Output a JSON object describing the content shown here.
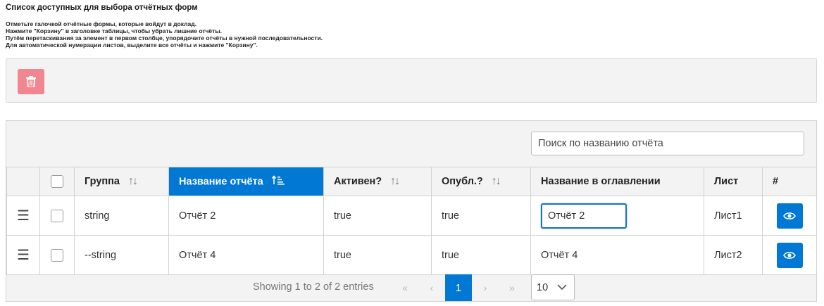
{
  "header": {
    "title": "Список доступных для выбора отчётных форм",
    "instructions": [
      "Отметьте галочкой отчётные формы, которые войдут в доклад.",
      "Нажмите \"Корзину\" в заголовке таблицы, чтобы убрать лишние отчёты.",
      "Путём перетаскивания за элемент в первом столбце, упорядочите отчёты в нужной последовательности.",
      "Для автоматической нумерации листов, выделите все отчёты и нажмите \"Корзину\"."
    ]
  },
  "toolbar": {
    "delete_icon": "trash-icon",
    "delete_color": "#f0868f"
  },
  "search": {
    "placeholder": "Поиск по названию отчёта",
    "value": ""
  },
  "table": {
    "columns": {
      "group": "Группа",
      "name": "Название отчёта",
      "active": "Активен?",
      "published": "Опубл.?",
      "toc_name": "Название в оглавлении",
      "sheet": "Лист",
      "actions": "#"
    },
    "sorted_column": "name",
    "sort_direction": "ascending",
    "rows": [
      {
        "group": "string",
        "name": "Отчёт 2",
        "active": "true",
        "published": "true",
        "toc_name": "Отчёт 2",
        "sheet": "Лист1",
        "editing": true
      },
      {
        "group": "--string",
        "name": "Отчёт 4",
        "active": "true",
        "published": "true",
        "toc_name": "Отчёт 4",
        "sheet": "Лист2",
        "editing": false
      }
    ]
  },
  "pagination": {
    "info": "Showing 1 to 2 of 2 entries",
    "first": "«",
    "prev": "‹",
    "current_page": "1",
    "next": "›",
    "last": "»",
    "page_size": "10"
  },
  "colors": {
    "accent": "#0078d4",
    "danger": "#f0868f",
    "panel": "#f3f3f3"
  }
}
